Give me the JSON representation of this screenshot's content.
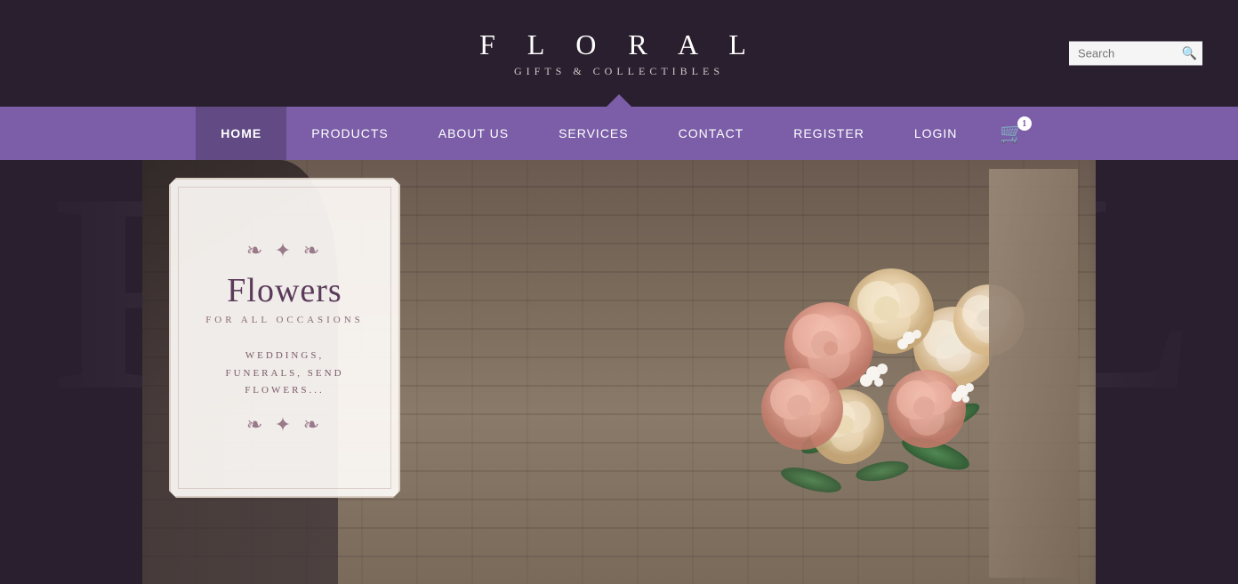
{
  "header": {
    "logo_title": "F L O R A L",
    "logo_subtitle": "GIFTS & COLLECTIBLES",
    "search_placeholder": "Search"
  },
  "nav": {
    "items": [
      {
        "label": "HOME",
        "active": true
      },
      {
        "label": "PRODUCTS",
        "active": false
      },
      {
        "label": "ABOUT US",
        "active": false
      },
      {
        "label": "SERVICES",
        "active": false
      },
      {
        "label": "CONTACT",
        "active": false
      },
      {
        "label": "REGISTER",
        "active": false
      },
      {
        "label": "LOGIN",
        "active": false
      }
    ],
    "cart_count": "1"
  },
  "hero": {
    "card_title": "Flowers",
    "card_subtitle": "FOR ALL OCCASIONS",
    "card_description_line1": "WEDDINGS,",
    "card_description_line2": "FUNERALS, SEND",
    "card_description_line3": "FLOWERS..."
  },
  "watermark": {
    "text": "FLORAL"
  }
}
